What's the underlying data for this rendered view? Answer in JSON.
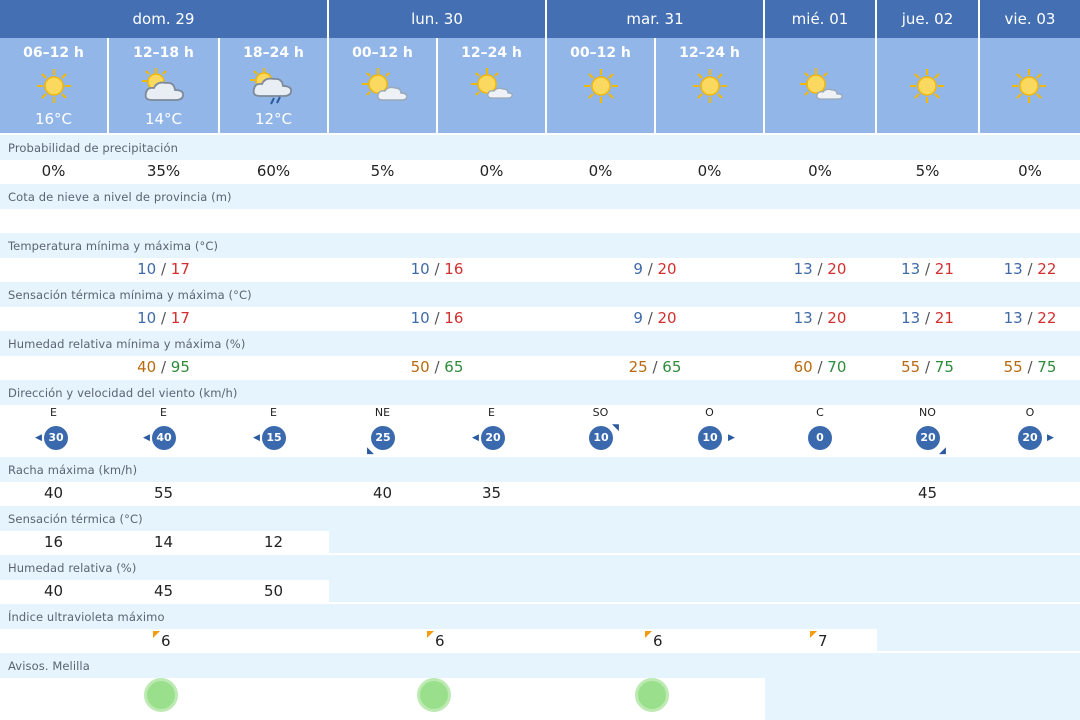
{
  "days": [
    {
      "label": "dom. 29"
    },
    {
      "label": "lun. 30"
    },
    {
      "label": "mar. 31"
    },
    {
      "label": "mié. 01"
    },
    {
      "label": "jue. 02"
    },
    {
      "label": "vie. 03"
    }
  ],
  "periods": [
    {
      "label": "06–12 h",
      "temp": "16°C",
      "icon": "sun-icon"
    },
    {
      "label": "12–18 h",
      "temp": "14°C",
      "icon": "partly-cloudy-icon"
    },
    {
      "label": "18–24 h",
      "temp": "12°C",
      "icon": "cloud-rain-icon"
    },
    {
      "label": "00–12 h",
      "temp": "",
      "icon": "sun-cloud-icon"
    },
    {
      "label": "12–24 h",
      "temp": "",
      "icon": "sun-cloud-icon"
    },
    {
      "label": "00–12 h",
      "temp": "",
      "icon": "sun-icon"
    },
    {
      "label": "12–24 h",
      "temp": "",
      "icon": "sun-icon"
    },
    {
      "label": "",
      "temp": "",
      "icon": "sun-cloud-icon"
    },
    {
      "label": "",
      "temp": "",
      "icon": "sun-icon"
    },
    {
      "label": "",
      "temp": "",
      "icon": "sun-icon"
    }
  ],
  "rows": {
    "precip": {
      "label": "Probabilidad de precipitación",
      "values": [
        "0%",
        "35%",
        "60%",
        "5%",
        "0%",
        "0%",
        "0%",
        "0%",
        "5%",
        "0%"
      ]
    },
    "snow": {
      "label": "Cota de nieve a nivel de provincia (m)"
    },
    "temp": {
      "label": "Temperatura mínima y máxima (°C)",
      "pairs": [
        [
          "10",
          "17"
        ],
        [
          "10",
          "16"
        ],
        [
          "9",
          "20"
        ],
        [
          "13",
          "20"
        ],
        [
          "13",
          "21"
        ],
        [
          "13",
          "22"
        ]
      ]
    },
    "feels": {
      "label": "Sensación térmica mínima y máxima (°C)",
      "pairs": [
        [
          "10",
          "17"
        ],
        [
          "10",
          "16"
        ],
        [
          "9",
          "20"
        ],
        [
          "13",
          "20"
        ],
        [
          "13",
          "21"
        ],
        [
          "13",
          "22"
        ]
      ]
    },
    "hum": {
      "label": "Humedad relativa mínima y máxima (%)",
      "pairs": [
        [
          "40",
          "95"
        ],
        [
          "50",
          "65"
        ],
        [
          "25",
          "65"
        ],
        [
          "60",
          "70"
        ],
        [
          "55",
          "75"
        ],
        [
          "55",
          "75"
        ]
      ]
    },
    "wind": {
      "label": "Dirección y velocidad del viento (km/h)",
      "dirs": [
        "E",
        "E",
        "E",
        "NE",
        "E",
        "SO",
        "O",
        "C",
        "NO",
        "O"
      ],
      "speeds": [
        "30",
        "40",
        "15",
        "25",
        "20",
        "10",
        "10",
        "0",
        "20",
        "20"
      ]
    },
    "gust": {
      "label": "Racha máxima (km/h)",
      "values": [
        "40",
        "55",
        "",
        "40",
        "35",
        "",
        "",
        "",
        "45",
        ""
      ]
    },
    "st": {
      "label": "Sensación térmica (°C)",
      "values": [
        "16",
        "14",
        "12"
      ]
    },
    "rh": {
      "label": "Humedad relativa (%)",
      "values": [
        "40",
        "45",
        "50"
      ]
    },
    "uv": {
      "label": "Índice ultravioleta máximo",
      "values": [
        "6",
        "6",
        "6",
        "7"
      ]
    },
    "avisos": {
      "label": "Avisos. Melilla"
    }
  },
  "colors": {
    "header": "#4470b3",
    "period": "#92b6e8",
    "band": "#e6f5fd",
    "min": "#3f6aa8",
    "max": "#d32f2f",
    "hum_min": "#b86a10",
    "hum_max": "#2e8b3a",
    "alert": "#9ae08c"
  }
}
